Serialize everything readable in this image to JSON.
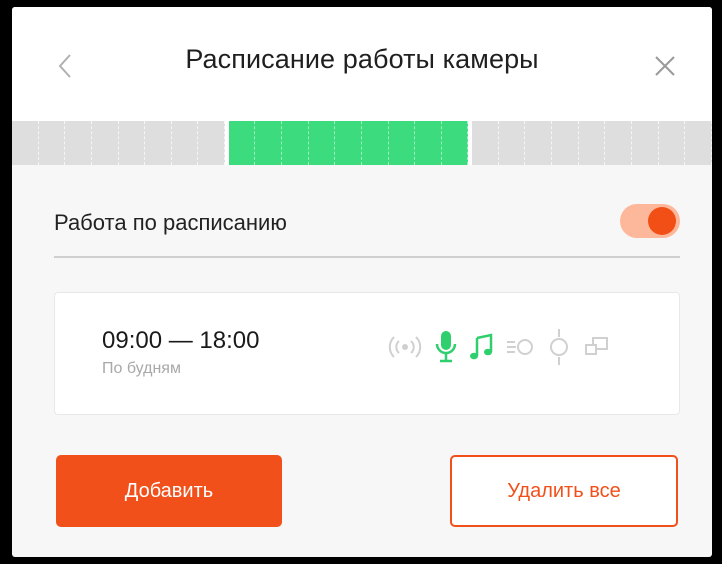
{
  "dialog": {
    "title": "Расписание работы камеры",
    "back_icon": "chevron-left-icon",
    "close_icon": "close-icon"
  },
  "timeline": {
    "active_color": "#3cdc7e",
    "inactive_color": "#dedede",
    "slots": [
      "off",
      "off",
      "off",
      "off",
      "off",
      "off",
      "off",
      "off",
      "gap",
      "on",
      "on",
      "on",
      "on",
      "on",
      "on",
      "on",
      "on",
      "on",
      "gap",
      "off",
      "off",
      "off",
      "off",
      "off",
      "off",
      "off",
      "off",
      "off"
    ]
  },
  "schedule_toggle": {
    "label": "Работа по расписанию",
    "enabled": true
  },
  "schedule_item": {
    "time_range": "09:00 — 18:00",
    "days": "По будням",
    "icons": [
      {
        "name": "broadcast-icon",
        "active": false
      },
      {
        "name": "microphone-icon",
        "active": true
      },
      {
        "name": "music-note-icon",
        "active": true
      },
      {
        "name": "motion-detector-icon",
        "active": false
      },
      {
        "name": "light-sensor-icon",
        "active": false
      },
      {
        "name": "screens-icon",
        "active": false
      }
    ]
  },
  "buttons": {
    "add_label": "Добавить",
    "delete_all_label": "Удалить все"
  },
  "colors": {
    "accent": "#f2501a",
    "active_icon": "#2fcf6e",
    "inactive_icon": "#d0d0d0"
  }
}
